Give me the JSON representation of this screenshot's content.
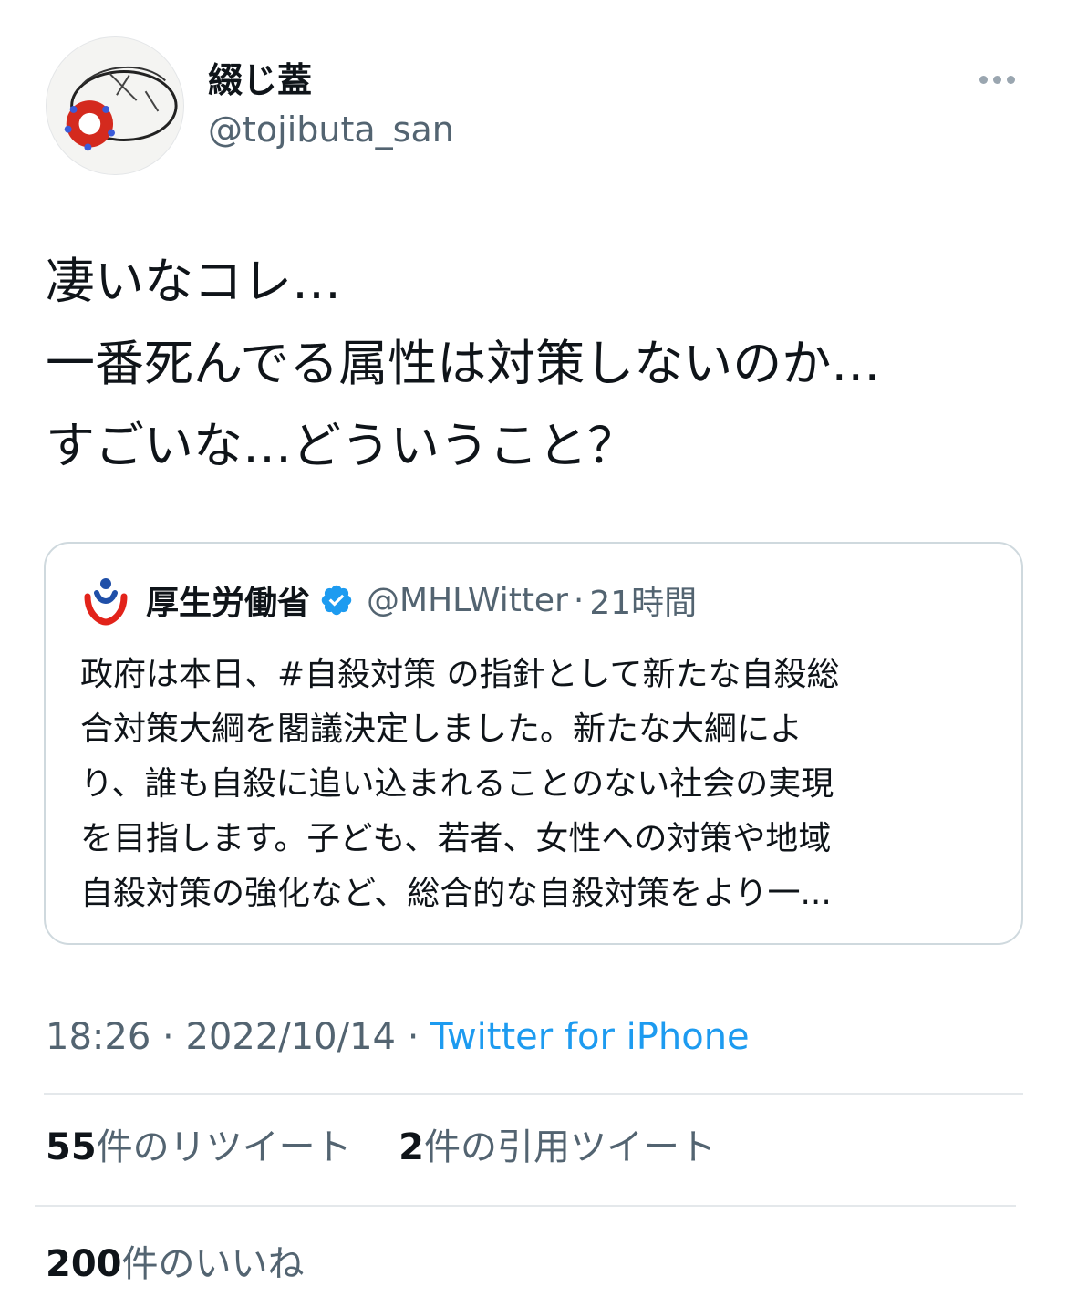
{
  "author": {
    "display_name": "綴じ蓋",
    "handle": "@tojibuta_san"
  },
  "tweet": {
    "lines": [
      "凄いなコレ…",
      "一番死んでる属性は対策しないのか…",
      "すごいな…どういうこと？"
    ]
  },
  "quoted_tweet": {
    "name": "厚生労働省",
    "handle": "@MHLWitter",
    "separator": "·",
    "time": "21時間",
    "lines": [
      "政府は本日、#自殺対策 の指針として新たな自殺総",
      "合対策大綱を閣議決定しました。新たな大綱によ",
      "り、誰も自殺に追い込まれることのない社会の実現",
      "を目指します。子ども、若者、女性への対策や地域",
      "自殺対策の強化など、総合的な自殺対策をより一..."
    ]
  },
  "meta": {
    "time": "18:26",
    "date": "2022/10/14",
    "separator": "·",
    "source": "Twitter for iPhone"
  },
  "stats": {
    "retweets_count": "55",
    "retweets_label": "件のリツイート",
    "quotes_count": "2",
    "quotes_label": "件の引用ツイート",
    "likes_count": "200",
    "likes_label": "件のいいね"
  },
  "icons": {
    "more": "more-horizontal-icon",
    "verified": "verified-badge-icon"
  },
  "colors": {
    "link": "#1d9bf0",
    "secondary_text": "#536471",
    "verified": "#1d9bf0",
    "border": "#cfd9de"
  }
}
